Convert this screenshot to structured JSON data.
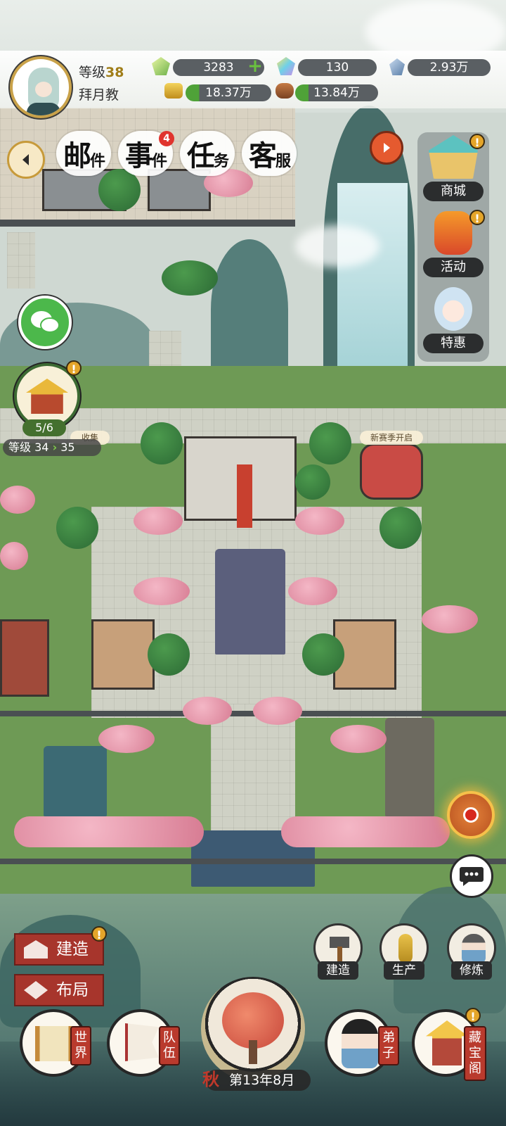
{
  "player": {
    "level_label": "等级",
    "level_value": "38",
    "sect_name": "拜月教"
  },
  "resources": {
    "jade": "3283",
    "rainbow_gem": "130",
    "crystal": "2.93万",
    "gold": "18.37万",
    "wood": "13.84万"
  },
  "menu": {
    "mail": {
      "big1": "邮",
      "sm1": "件"
    },
    "events": {
      "big1": "事",
      "sm1": "件",
      "badge": "4"
    },
    "tasks": {
      "big1": "任",
      "sm1": "务"
    },
    "service": {
      "big1": "客",
      "sm1": "服"
    }
  },
  "right_panel": {
    "shop": "商城",
    "activity": "活动",
    "deals": "特惠"
  },
  "building_widget": {
    "count": "5/6",
    "level_label": "等级",
    "level_from": "34",
    "level_to": "35"
  },
  "map_tags": {
    "collect": "收集",
    "new_season": "新赛季开启"
  },
  "left_buttons": {
    "build": "建造",
    "layout": "布局"
  },
  "tools": {
    "build": "建造",
    "produce": "生产",
    "cultivate": "修炼"
  },
  "bottom_nav": {
    "world": "世界",
    "team": "队伍",
    "disciples": "弟子",
    "treasury": "藏宝阁"
  },
  "calendar": {
    "season": "秋",
    "date": "第13年8月"
  },
  "badges": {
    "exclaim": "!"
  },
  "icons": {
    "back": "chevron-left-icon",
    "next": "chevron-right-icon",
    "chat": "speech-bubble-icon",
    "wechat": "wechat-icon"
  },
  "colors": {
    "accent_gold": "#c9a24a",
    "red_button": "#a7352c",
    "resource_bar": "#5a5f63",
    "green_fill": "#4fa238"
  }
}
